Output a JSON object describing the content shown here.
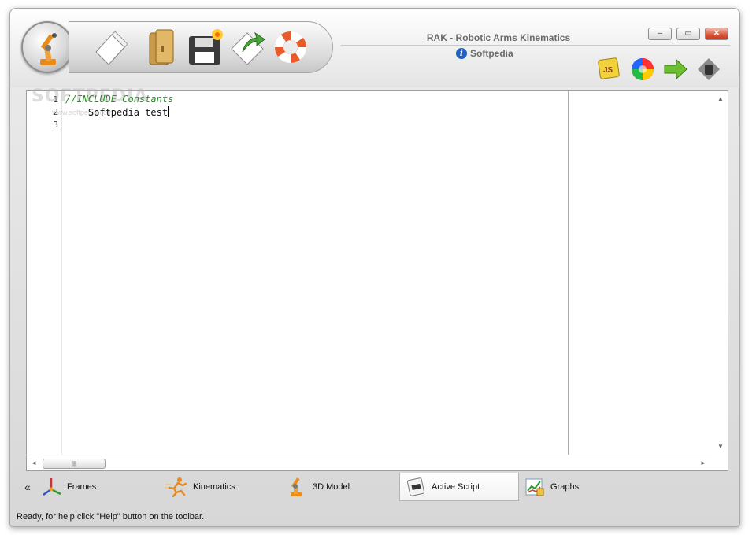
{
  "window": {
    "title": "RAK - Robotic Arms Kinematics",
    "subtitle": "Softpedia"
  },
  "toolbar": {
    "buttons": [
      "new-document",
      "open-folder",
      "save",
      "save-as",
      "help"
    ]
  },
  "window_controls": {
    "minimize": "‒",
    "maximize": "▭",
    "close": "✕"
  },
  "editor": {
    "watermark": "SOFTPEDIA",
    "watermark_sub": "www.softpedia.com",
    "line_numbers": [
      "1",
      "2",
      "3"
    ],
    "lines": [
      "//INCLUDE Constants",
      "    Softpedia test",
      ""
    ]
  },
  "scroll": {
    "up": "▲",
    "down": "▼",
    "left": "◄",
    "right": "►",
    "thumb_grip": "|||"
  },
  "tabs": {
    "collapse": "«",
    "items": [
      {
        "label": "Frames"
      },
      {
        "label": "Kinematics"
      },
      {
        "label": "3D Model"
      },
      {
        "label": "Active Script"
      },
      {
        "label": "Graphs"
      }
    ],
    "active_index": 3
  },
  "status": {
    "text": "Ready, for help click \"Help\" button on the toolbar."
  },
  "colors": {
    "comment": "#2e8b2e",
    "accent_orange": "#e88b1a",
    "close_red": "#d8553a"
  }
}
